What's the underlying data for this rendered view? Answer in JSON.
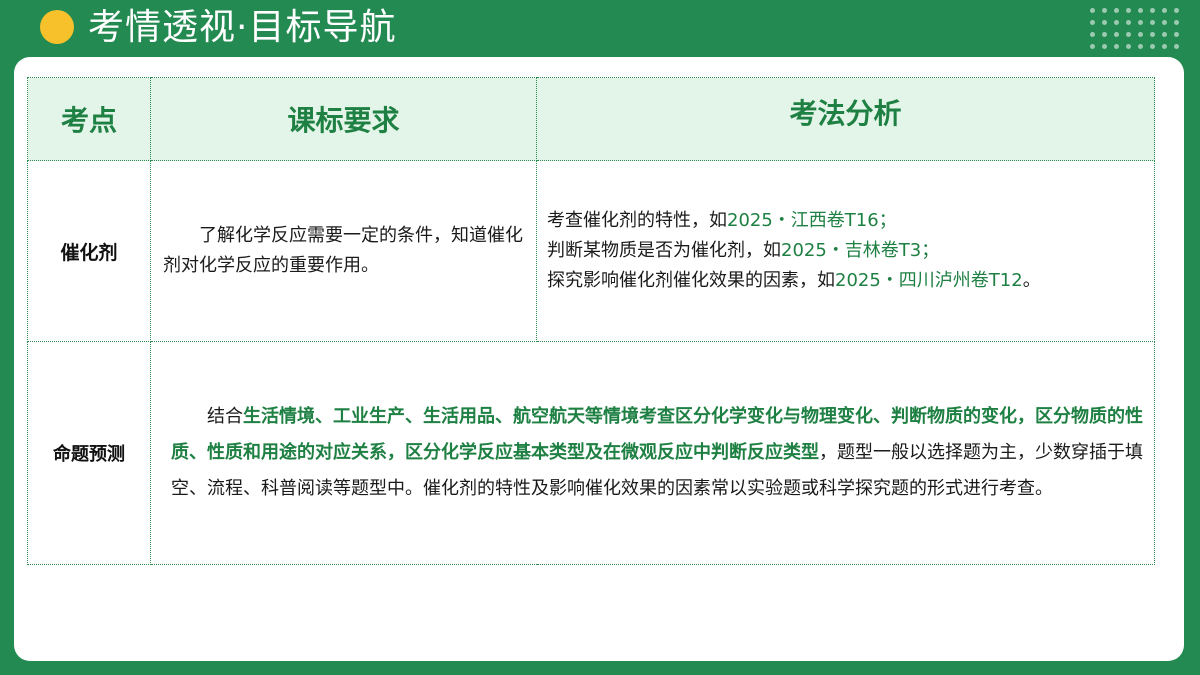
{
  "header": {
    "title": "考情透视·目标导航"
  },
  "colors": {
    "background": "#238a52",
    "accent_dot": "#f7c12c",
    "header_fill": "#e3f5e8",
    "highlight": "#1f8043"
  },
  "table": {
    "headers": [
      "考点",
      "课标要求",
      "考法分析"
    ],
    "rows": [
      {
        "label": "催化剂",
        "requirement": "了解化学反应需要一定的条件，知道催化剂对化学反应的重要作用。",
        "analysis": [
          {
            "text": "考查催化剂的特性，如",
            "ref": "2025・江西卷T16；",
            "tail": ""
          },
          {
            "text": "判断某物质是否为催化剂，如",
            "ref": "2025・吉林卷T3；",
            "tail": ""
          },
          {
            "text": "探究影响催化剂催化效果的因素，如",
            "ref": "2025・四川泸州卷T12",
            "tail": "。"
          }
        ]
      },
      {
        "label": "命题预测",
        "prediction": {
          "lead": "结合",
          "highlight": "生活情境、工业生产、生活用品、航空航天等情境考查区分化学变化与物理变化、判断物质的变化，区分物质的性质、性质和用途的对应关系，区分化学反应基本类型及在微观反应中判断反应类型",
          "rest": "，题型一般以选择题为主，少数穿插于填空、流程、科普阅读等题型中。催化剂的特性及影响催化效果的因素常以实验题或科学探究题的形式进行考查。"
        }
      }
    ]
  }
}
